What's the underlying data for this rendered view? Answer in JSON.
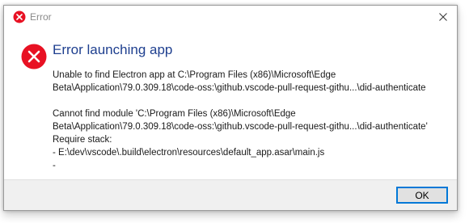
{
  "window": {
    "title": "Error"
  },
  "dialog": {
    "heading": "Error launching app",
    "message_lines": [
      "Unable to find Electron app at C:\\Program Files (x86)\\Microsoft\\Edge",
      "Beta\\Application\\79.0.309.18\\code-oss:\\github.vscode-pull-request-githu...\\did-authenticate",
      "",
      "Cannot find module 'C:\\Program Files (x86)\\Microsoft\\Edge",
      "Beta\\Application\\79.0.309.18\\code-oss:\\github.vscode-pull-request-githu...\\did-authenticate'",
      "Require stack:",
      "- E:\\dev\\vscode\\.build\\electron\\resources\\default_app.asar\\main.js",
      "-"
    ]
  },
  "footer": {
    "ok_label": "OK"
  },
  "icons": {
    "title": "error-icon",
    "main": "error-icon",
    "close": "close-icon"
  },
  "colors": {
    "error_red": "#e81123",
    "heading_blue": "#1e3f8f",
    "button_focus": "#0078d7",
    "footer_bg": "#f0f0f0"
  }
}
